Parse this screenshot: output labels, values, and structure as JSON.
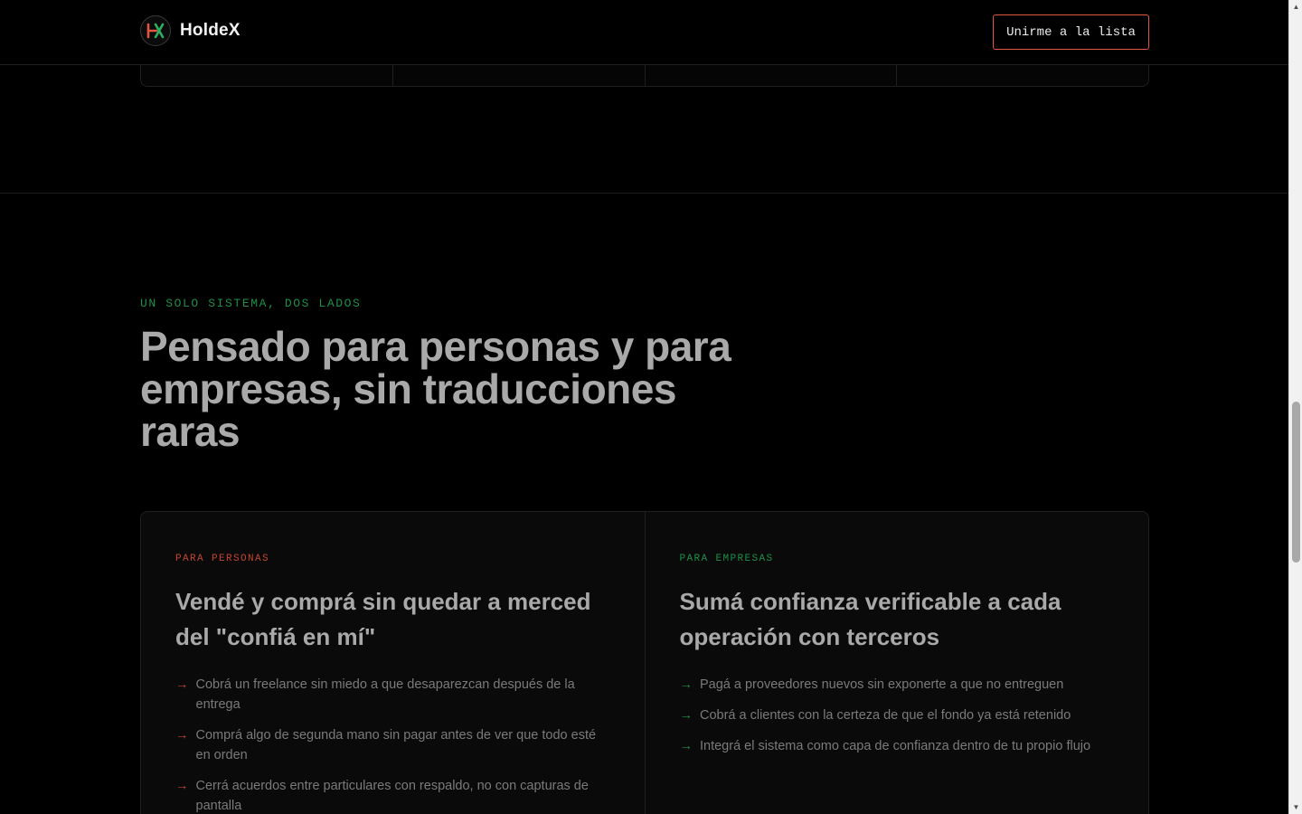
{
  "nav": {
    "brand_name": "HoldeX",
    "cta_label": "Unirme a la lista"
  },
  "section": {
    "eyebrow": "UN SOLO SISTEMA, DOS LADOS",
    "heading": "Pensado para personas y para empresas, sin traducciones raras"
  },
  "cards": [
    {
      "label": "PARA PERSONAS",
      "title": "Vendé y comprá sin quedar a merced del \"confiá en mí\"",
      "items": [
        "Cobrá un freelance sin miedo a que desaparezcan después de la entrega",
        "Comprá algo de segunda mano sin pagar antes de ver que todo esté en orden",
        "Cerrá acuerdos entre particulares con respaldo, no con capturas de pantalla"
      ]
    },
    {
      "label": "PARA EMPRESAS",
      "title": "Sumá confianza verificable a cada operación con terceros",
      "items": [
        "Pagá a proveedores nuevos sin exponerte a que no entreguen",
        "Cobrá a clientes con la certeza de que el fondo ya está retenido",
        "Integrá el sistema como capa de confianza dentro de tu propio flujo"
      ]
    }
  ],
  "glyphs": {
    "arrow": "→",
    "scroll_up": "▲",
    "scroll_down": "▼"
  },
  "colors": {
    "accent_red": "#c2452f",
    "accent_green": "#1e8f4a",
    "background": "#000000"
  }
}
